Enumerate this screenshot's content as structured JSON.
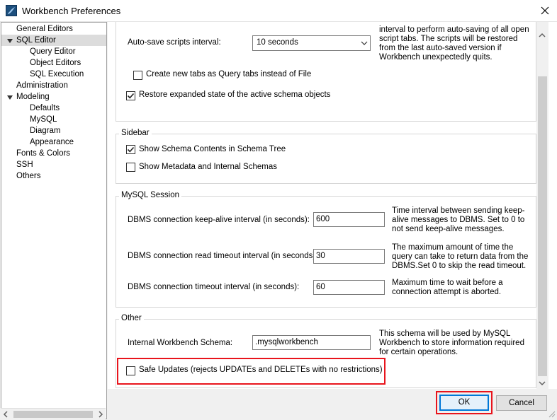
{
  "window": {
    "title": "Workbench Preferences"
  },
  "tree": {
    "items": [
      {
        "label": "General Editors",
        "level": 0,
        "expandable": false,
        "selected": false
      },
      {
        "label": "SQL Editor",
        "level": 0,
        "expandable": true,
        "selected": true
      },
      {
        "label": "Query Editor",
        "level": 1,
        "expandable": false,
        "selected": false
      },
      {
        "label": "Object Editors",
        "level": 1,
        "expandable": false,
        "selected": false
      },
      {
        "label": "SQL Execution",
        "level": 1,
        "expandable": false,
        "selected": false
      },
      {
        "label": "Administration",
        "level": 0,
        "expandable": false,
        "selected": false
      },
      {
        "label": "Modeling",
        "level": 0,
        "expandable": true,
        "selected": false
      },
      {
        "label": "Defaults",
        "level": 1,
        "expandable": false,
        "selected": false
      },
      {
        "label": "MySQL",
        "level": 1,
        "expandable": false,
        "selected": false
      },
      {
        "label": "Diagram",
        "level": 1,
        "expandable": false,
        "selected": false
      },
      {
        "label": "Appearance",
        "level": 1,
        "expandable": false,
        "selected": false
      },
      {
        "label": "Fonts & Colors",
        "level": 0,
        "expandable": false,
        "selected": false
      },
      {
        "label": "SSH",
        "level": 0,
        "expandable": false,
        "selected": false
      },
      {
        "label": "Others",
        "level": 0,
        "expandable": false,
        "selected": false
      }
    ]
  },
  "top": {
    "autosave_label": "Auto-save scripts interval:",
    "autosave_value": "10 seconds",
    "autosave_desc": "interval to perform auto-saving of all open script tabs. The scripts will be restored from the last auto-saved version if Workbench unexpectedly quits.",
    "new_tabs_label": "Create new tabs as Query tabs instead of File",
    "new_tabs_checked": false,
    "restore_label": "Restore expanded state of the active schema objects",
    "restore_checked": true
  },
  "sidebar": {
    "title": "Sidebar",
    "schema_contents_label": "Show Schema Contents in Schema Tree",
    "schema_contents_checked": true,
    "metadata_label": "Show Metadata and Internal Schemas",
    "metadata_checked": false
  },
  "session": {
    "title": "MySQL Session",
    "keepalive_label": "DBMS connection keep-alive interval (in seconds):",
    "keepalive_value": "600",
    "keepalive_desc": "Time interval between sending keep-alive messages to DBMS. Set to 0 to not send keep-alive messages.",
    "read_timeout_label": "DBMS connection read timeout interval (in seconds):",
    "read_timeout_value": "30",
    "read_timeout_desc": "The maximum amount of time the query can take to return data from the DBMS.Set 0 to skip the read timeout.",
    "conn_timeout_label": "DBMS connection timeout interval (in seconds):",
    "conn_timeout_value": "60",
    "conn_timeout_desc": "Maximum time to wait before a connection attempt is aborted."
  },
  "other": {
    "title": "Other",
    "schema_label": "Internal Workbench Schema:",
    "schema_value": ".mysqlworkbench",
    "schema_desc": "This schema will be used by MySQL Workbench to store information required for certain operations.",
    "safe_updates_label": "Safe Updates (rejects UPDATEs and DELETEs with no restrictions)",
    "safe_updates_checked": false
  },
  "buttons": {
    "ok": "OK",
    "cancel": "Cancel"
  },
  "colors": {
    "highlight": "#e8141c",
    "accent": "#0078d7",
    "selection": "#dcdcdc"
  }
}
